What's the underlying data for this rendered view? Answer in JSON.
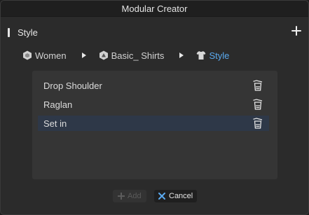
{
  "window": {
    "title": "Modular Creator"
  },
  "section": {
    "title": "Style",
    "add_icon": "plus-icon"
  },
  "breadcrumb": [
    {
      "label": "Women",
      "icon": "hexagon-icon"
    },
    {
      "label": "Basic_ Shirts",
      "icon": "fabric-icon"
    },
    {
      "label": "Style",
      "icon": "shirt-icon",
      "active": true
    }
  ],
  "list": {
    "items": [
      {
        "label": "Drop Shoulder",
        "selected": false
      },
      {
        "label": "Raglan",
        "selected": false
      },
      {
        "label": "Set in",
        "selected": true
      }
    ]
  },
  "buttons": {
    "add_label": "Add",
    "cancel_label": "Cancel"
  },
  "colors": {
    "accent": "#5aa9ee",
    "selected_row": "#2e3848",
    "background": "#2b2b2b"
  }
}
